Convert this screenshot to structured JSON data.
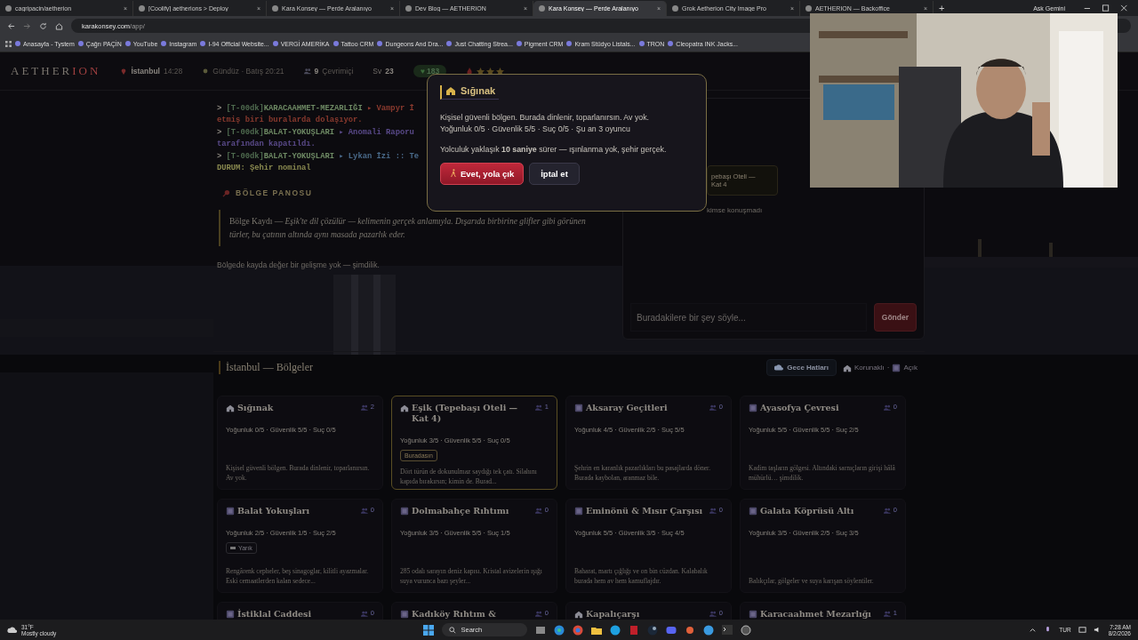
{
  "browser": {
    "tabs": [
      {
        "title": "cagripacin/aetherion",
        "selected": false
      },
      {
        "title": "[Coolify] aetherions > Deploy",
        "selected": false
      },
      {
        "title": "Kara Konsey — Perde Aralanıyo",
        "selected": false
      },
      {
        "title": "Dev Blog — AETHERION",
        "selected": false
      },
      {
        "title": "Kara Konsey — Perde Aralanıyo",
        "selected": true
      },
      {
        "title": "Grok Aetherion City Image Pro",
        "selected": false
      },
      {
        "title": "AETHERION — Backoffice",
        "selected": false
      }
    ],
    "tab_close": "×",
    "new_tab": "+",
    "assistant": "Ask Gemini",
    "url_host": "karakonsey.com",
    "url_path": "/app/",
    "bookmarks": [
      "Anasayfa - Tystem",
      "Çağrı PAÇİN",
      "YouTube",
      "Instagram",
      "I-94 Official Website...",
      "VERGİ AMERİKA",
      "Tattoo CRM",
      "Dungeons And Dra...",
      "Just Chatting Strea...",
      "Pigment CRM",
      "Kram Stüdyo Listals...",
      "TRON",
      "Cleopatra INK Jacks..."
    ]
  },
  "header": {
    "logo_main": "AETHER",
    "logo_accent": "ION",
    "city": "İstanbul",
    "time": "14:28",
    "daylight": "Gündüz · Batış 20:21",
    "online_count": "9",
    "online_label": "Çevrimiçi",
    "level_label": "Sv",
    "level": "23",
    "heart": "♥",
    "hearts": "183",
    "stars": 3
  },
  "log": {
    "entries": [
      {
        "prompt": ">",
        "stamp": "[T-00dk]",
        "place": "KARACAAHMET-MEZARLIĞI",
        "event": "▸ Vampyr İ",
        "continuation": "etmiş biri buralarda dolaşıyor.",
        "color": "#8a3a2e"
      },
      {
        "prompt": ">",
        "stamp": "[T-00dk]",
        "place": "BALAT-YOKUŞLARI",
        "event": "▸ Anomali Raporu",
        "continuation": "tarafından kapatıldı.",
        "color": "#5a4a8a"
      },
      {
        "prompt": ">",
        "stamp": "[T-00dk]",
        "place": "BALAT-YOKUŞLARI",
        "event": "▸ Lykan İzi :: Te",
        "color": "#4a6a8a"
      }
    ],
    "status": "DURUM: Şehir nominal"
  },
  "board": {
    "title": "BÖLGE PANOSU",
    "quote": "Bölge Kaydı — *Eşik'te dil çözülür — kelimenin gerçek anlamıyla. Dışarıda birbirine glifler gibi görünen türler, bu çatının altında aynı masada pazarlık eder.*",
    "note": "Bölgede kayda değer bir gelişme yok — şimdilik."
  },
  "chat": {
    "location": "pebaşı Oteli —",
    "location_line2": "Kat 4",
    "empty": "kimse konuşmadı",
    "placeholder": "Buradakilere bir şey söyle...",
    "send": "Gönder"
  },
  "regions": {
    "title": "İstanbul — Bölgeler",
    "night_button": "Gece Hatları",
    "legend": [
      {
        "kind": "shelter",
        "label": "Korunaklı"
      },
      {
        "kind": "open",
        "label": "Açık"
      }
    ],
    "legend_separator": "·",
    "cards": [
      {
        "kind": "shelter",
        "title": "Sığınak",
        "count": "2",
        "stats": "Yoğunluk 0/5 · Güvenlik 5/5 · Suç 0/5",
        "desc": "Kişisel güvenli bölgen. Burada dinlenir, toparlanırsın. Av yok.",
        "selected": false
      },
      {
        "kind": "shelter",
        "title": "Eşik (Tepebaşı Oteli — Kat 4)",
        "count": "1",
        "stats": "Yoğunluk 3/5 · Güvenlik 5/5 · Suç 0/5",
        "tag": {
          "kind": "here",
          "label": "Buradasın"
        },
        "desc": "Dört türün de dokunulmaz saydığı tek çatı. Silahını kapıda bırakırsın; kimin de. Burad...",
        "selected": true
      },
      {
        "kind": "open",
        "title": "Aksaray Geçitleri",
        "count": "0",
        "stats": "Yoğunluk 4/5 · Güvenlik 2/5 · Suç 5/5",
        "desc": "Şehrin en karanlık pazarlıkları bu pasajlarda döner. Burada kaybolan, aranmaz bile.",
        "selected": false
      },
      {
        "kind": "open",
        "title": "Ayasofya Çevresi",
        "count": "0",
        "stats": "Yoğunluk 5/5 · Güvenlik 5/5 · Suç 2/5",
        "desc": "Kadim taşların gölgesi. Altındaki sarnıçların girişi hâlâ mühürlü… şimdilik.",
        "selected": false
      },
      {
        "kind": "open",
        "title": "Balat Yokuşları",
        "count": "0",
        "stats": "Yoğunluk 2/5 · Güvenlik 1/5 · Suç 2/5",
        "tag": {
          "kind": "rift",
          "label": "Yarık"
        },
        "desc": "Rengârenk cepheler, beş sinagoglar, kilitli ayazmalar. Eski cemaatlerden kalan sedece...",
        "selected": false
      },
      {
        "kind": "open",
        "title": "Dolmabahçe Rıhtımı",
        "count": "0",
        "stats": "Yoğunluk 3/5 · Güvenlik 5/5 · Suç 1/5",
        "desc": "285 odalı sarayın deniz kapısı. Kristal avizelerin ışığı suya vurunca bazı şeyler...",
        "selected": false
      },
      {
        "kind": "open",
        "title": "Eminönü & Mısır Çarşısı",
        "count": "0",
        "stats": "Yoğunluk 5/5 · Güvenlik 3/5 · Suç 4/5",
        "desc": "Baharat, martı çığlığı ve on bin cüzdan. Kalabalık burada hem av hem kamuflajdır.",
        "selected": false
      },
      {
        "kind": "open",
        "title": "Galata Köprüsü Altı",
        "count": "0",
        "stats": "Yoğunluk 3/5 · Güvenlik 2/5 · Suç 3/5",
        "desc": "Balıkçılar, gölgeler ve suya karışan söylentiler.",
        "selected": false
      },
      {
        "kind": "open",
        "title": "İstiklal Caddesi",
        "count": "0",
        "selected": false
      },
      {
        "kind": "open",
        "title": "Kadıköy Rıhtım &",
        "count": "0",
        "selected": false
      },
      {
        "kind": "shelter",
        "title": "Kapalıçarşı",
        "count": "0",
        "selected": false
      },
      {
        "kind": "open",
        "title": "Karacaahmet Mezarlığı",
        "count": "1",
        "selected": false
      }
    ]
  },
  "modal": {
    "title": "Sığınak",
    "lines": [
      "Kişisel güvenli bölgen. Burada dinlenir, toparlanırsın. Av yok.",
      "Yoğunluk 0/5 · Güvenlik 5/5 · Suç 0/5 · Şu an 3 oyuncu"
    ],
    "travel": "Yolculuk yaklaşık **10 saniye** sürer — ışınlanma yok, şehir gerçek.",
    "confirm": "Evet, yola çık",
    "cancel": "İptal et"
  },
  "taskbar": {
    "temperature": "31°F",
    "weather": "Mostly cloudy",
    "search": "Search",
    "language": "TUR",
    "time": "7:28 AM",
    "date": "8/2/2026"
  }
}
